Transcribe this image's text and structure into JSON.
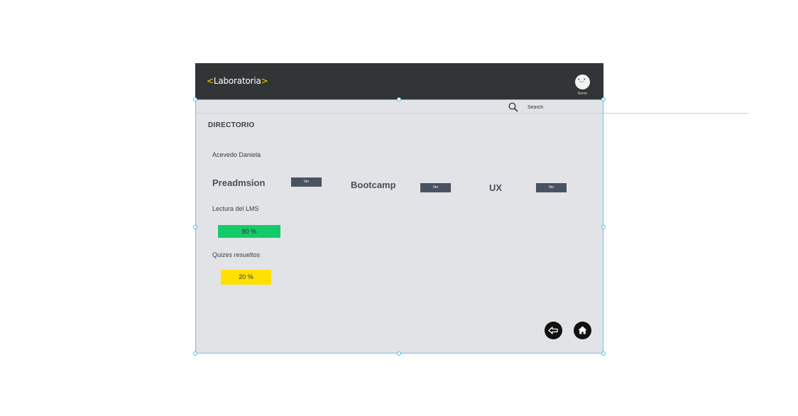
{
  "header": {
    "logo_open": "<",
    "logo_text": "Laboratoria",
    "logo_close": ">",
    "avatar_face": "•‿•",
    "avatar_label": "Nome"
  },
  "search": {
    "placeholder": "Search",
    "icon": "search-icon"
  },
  "directory": {
    "title": "DIRECTORIO",
    "student_name": "Acevedo Daniela"
  },
  "stages": [
    {
      "label": "Preadmsion",
      "button": "Ver"
    },
    {
      "label": "Bootcamp",
      "button": "Ver"
    },
    {
      "label": "UX",
      "button": "Ver"
    }
  ],
  "metrics": {
    "lms_label": "Lectura del LMS",
    "lms_value": "80 %",
    "lms_color": "#14cb69",
    "quiz_label": "Quizes resueltos",
    "quiz_value": "20 %",
    "quiz_color": "#ffe000"
  },
  "nav": {
    "back_icon": "back-arrow-icon",
    "home_icon": "home-icon"
  },
  "colors": {
    "header_bg": "#323535",
    "panel_bg": "#e2e3e7",
    "accent": "#f5d300",
    "selection": "#6cc4ef"
  }
}
